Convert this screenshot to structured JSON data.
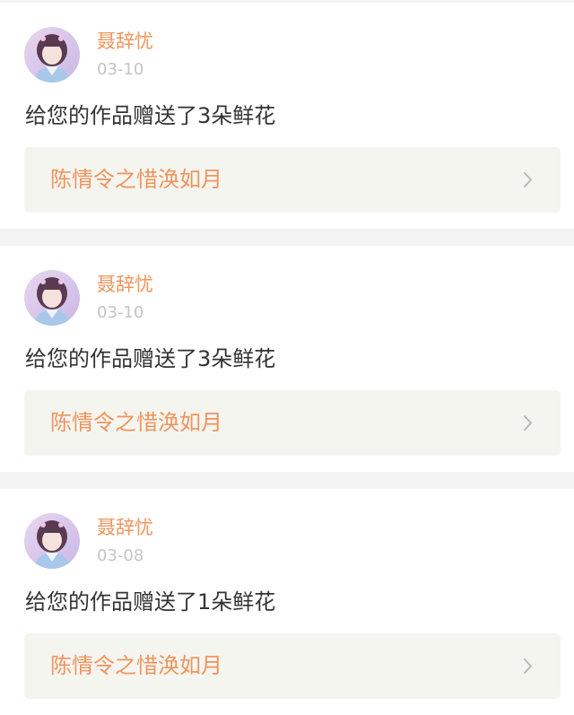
{
  "colors": {
    "accent": "#f0945c",
    "date": "#c4c4c4",
    "text": "#333333",
    "panel": "#f5f5f0",
    "background": "#f4f4f4"
  },
  "notifications": [
    {
      "username": "聂辞忧",
      "date": "03-10",
      "message": "给您的作品赠送了3朵鲜花",
      "work_title": "陈情令之惜涣如月",
      "avatar_icon": "avatar-girl-portrait",
      "link_icon": "chevron-right-icon"
    },
    {
      "username": "聂辞忧",
      "date": "03-10",
      "message": "给您的作品赠送了3朵鲜花",
      "work_title": "陈情令之惜涣如月",
      "avatar_icon": "avatar-girl-portrait",
      "link_icon": "chevron-right-icon"
    },
    {
      "username": "聂辞忧",
      "date": "03-08",
      "message": "给您的作品赠送了1朵鲜花",
      "work_title": "陈情令之惜涣如月",
      "avatar_icon": "avatar-girl-portrait",
      "link_icon": "chevron-right-icon"
    }
  ]
}
